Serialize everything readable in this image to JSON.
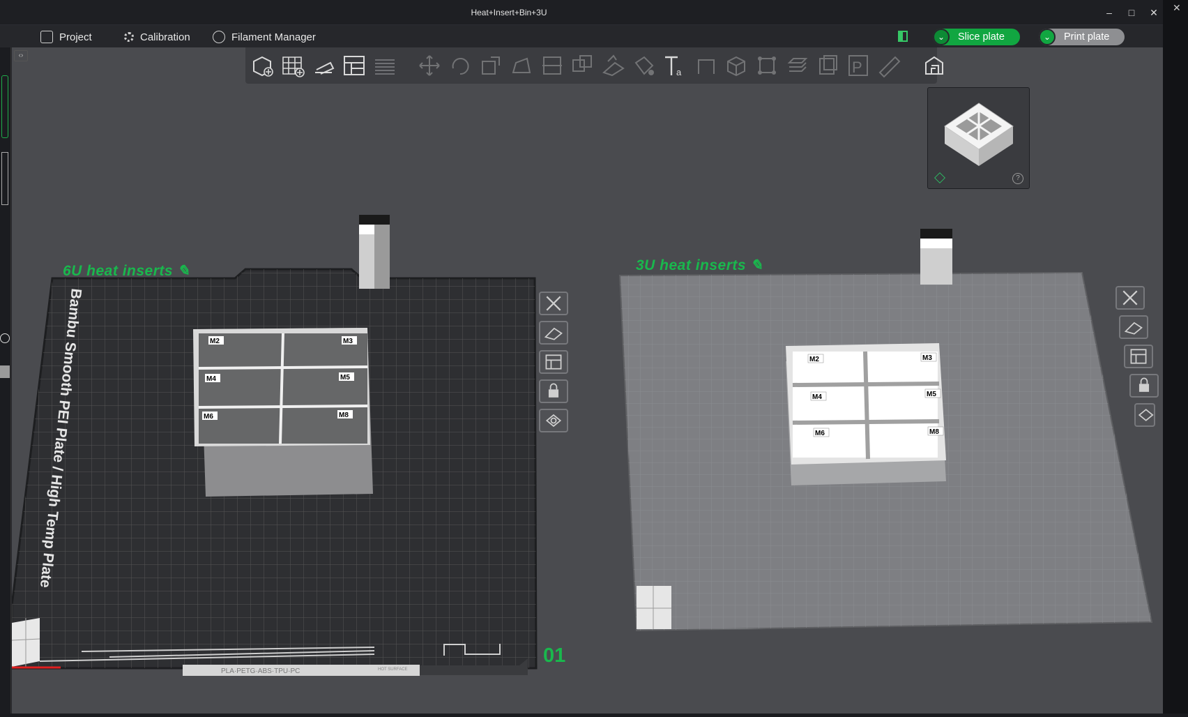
{
  "window": {
    "title": "Heat+Insert+Bin+3U"
  },
  "menu": {
    "project": "Project",
    "calibration": "Calibration",
    "filament_manager": "Filament Manager"
  },
  "actions": {
    "slice_plate": "Slice plate",
    "print_plate": "Print plate"
  },
  "plates": [
    {
      "title": "6U heat inserts",
      "number": "01",
      "bed_label": "Bambu Smooth PEI Plate / High Temp Plate",
      "bed_footer": "PLA·PETG·ABS·TPU·PC",
      "bed_footer2": "HOT SURFACE",
      "bin_labels": [
        "M2",
        "M3",
        "M4",
        "M5",
        "M6",
        "M8"
      ]
    },
    {
      "title": "3U heat inserts",
      "bin_labels": [
        "M2",
        "M3",
        "M4",
        "M5",
        "M6",
        "M8"
      ]
    }
  ],
  "colors": {
    "accent": "#19b84d",
    "viewport": "#4a4b4f",
    "toolbar": "#3b3c40"
  },
  "icons": [
    "add-object-icon",
    "add-plate-icon",
    "auto-orient-icon",
    "arrange-icon",
    "split-icon",
    "move-icon",
    "rotate-icon",
    "scale-icon",
    "lay-on-face-icon",
    "cut-icon",
    "boolean-icon",
    "support-paint-icon",
    "seam-paint-icon",
    "color-paint-icon",
    "text-icon",
    "measure-icon",
    "assemble-icon",
    "preview-icon"
  ]
}
